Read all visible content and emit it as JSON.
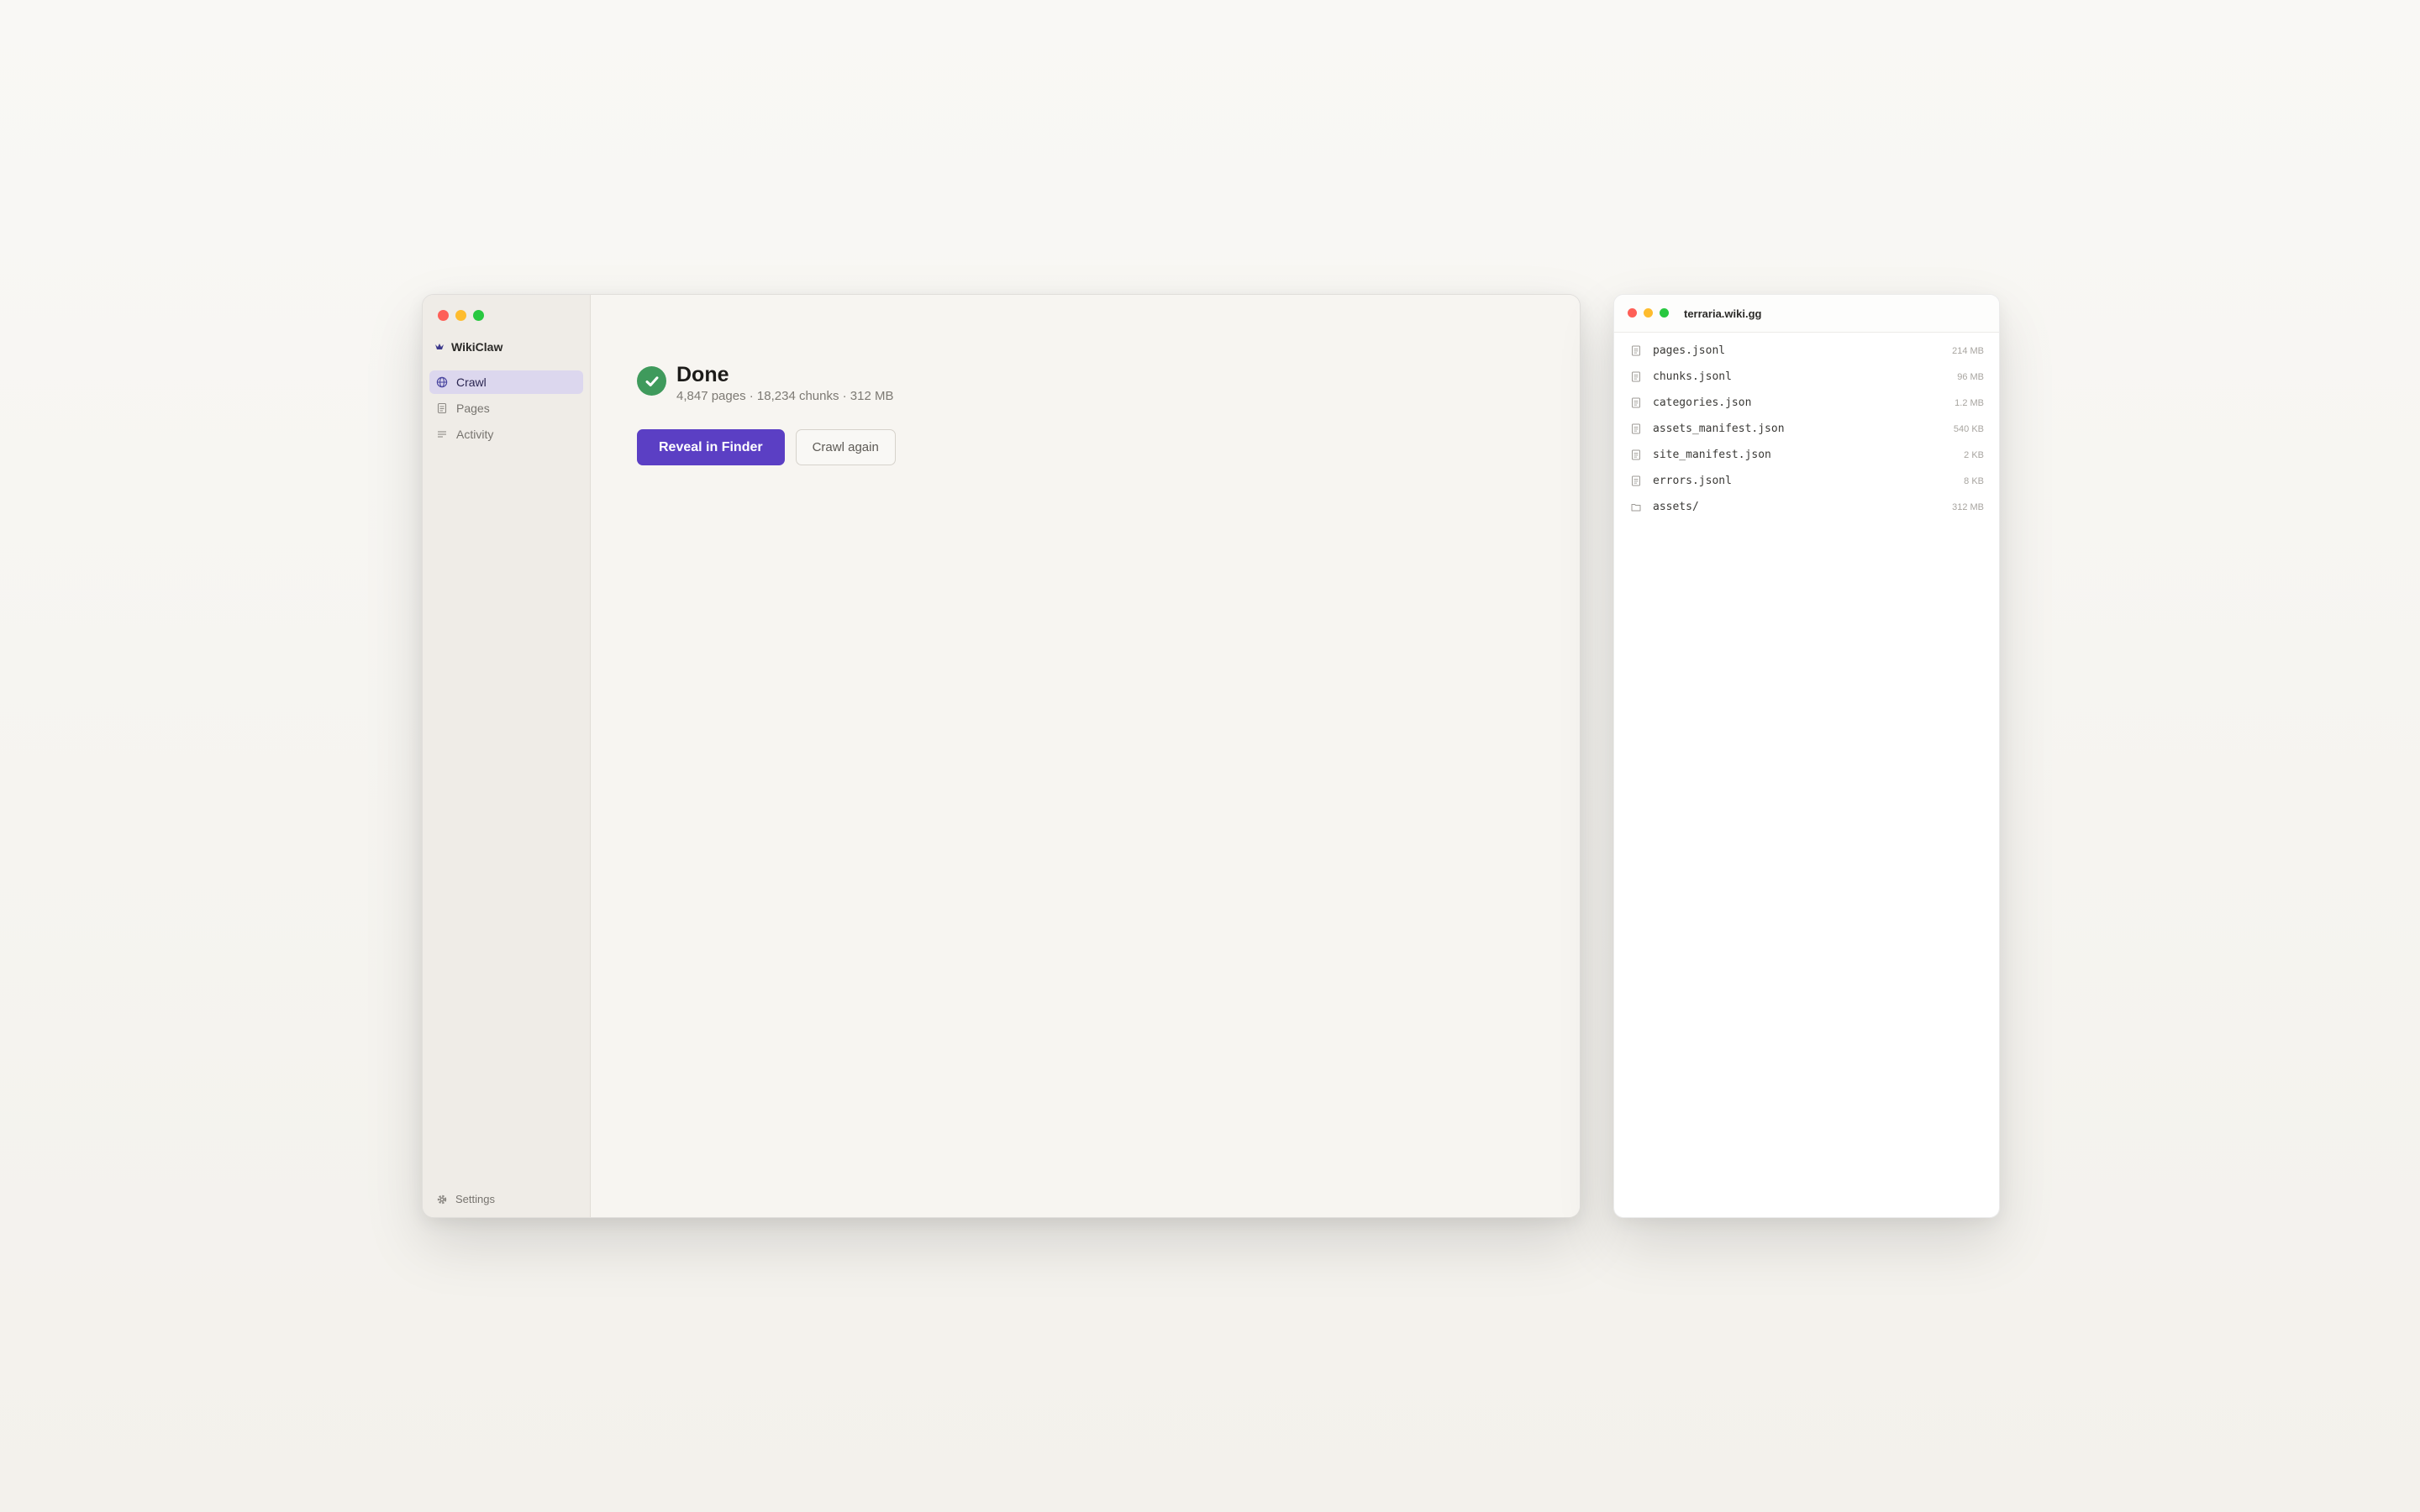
{
  "app": {
    "name": "WikiClaw",
    "nav": [
      {
        "label": "Crawl",
        "icon": "globe-icon",
        "active": true
      },
      {
        "label": "Pages",
        "icon": "document-icon",
        "active": false
      },
      {
        "label": "Activity",
        "icon": "list-icon",
        "active": false
      }
    ],
    "settings_label": "Settings"
  },
  "status": {
    "title": "Done",
    "subtitle": "4,847 pages · 18,234 chunks · 312 MB",
    "icon": "checkmark-icon",
    "color": "#3f9a5c"
  },
  "actions": {
    "primary_label": "Reveal in Finder",
    "secondary_label": "Crawl again",
    "accent_color": "#5b3fc4"
  },
  "finder": {
    "title": "terraria.wiki.gg",
    "files": [
      {
        "name": "pages.jsonl",
        "size": "214 MB",
        "icon": "file-icon"
      },
      {
        "name": "chunks.jsonl",
        "size": "96 MB",
        "icon": "file-icon"
      },
      {
        "name": "categories.json",
        "size": "1.2 MB",
        "icon": "file-icon"
      },
      {
        "name": "assets_manifest.json",
        "size": "540 KB",
        "icon": "file-icon"
      },
      {
        "name": "site_manifest.json",
        "size": "2 KB",
        "icon": "file-icon"
      },
      {
        "name": "errors.jsonl",
        "size": "8 KB",
        "icon": "file-icon"
      },
      {
        "name": "assets/",
        "size": "312 MB",
        "icon": "folder-icon"
      }
    ]
  }
}
